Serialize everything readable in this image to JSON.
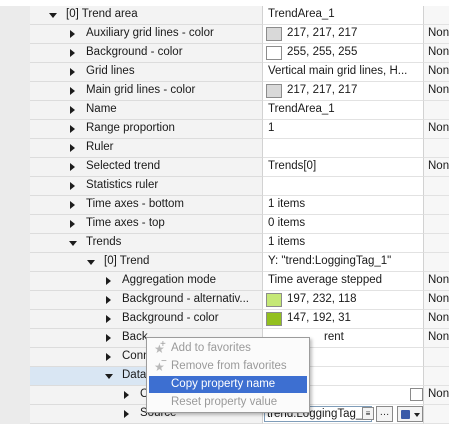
{
  "rows": [
    {
      "label": "[0] Trend area",
      "value": "TrendArea_1",
      "col3": "",
      "level": 0,
      "expander": "down"
    },
    {
      "label": "Auxiliary grid lines - color",
      "value": "217, 217, 217",
      "col3": "Non",
      "level": 1,
      "expander": "right",
      "swatch": "#d9d9d9"
    },
    {
      "label": "Background - color",
      "value": "255, 255, 255",
      "col3": "Non",
      "level": 1,
      "expander": "right",
      "swatch": "#ffffff"
    },
    {
      "label": "Grid lines",
      "value": "Vertical main grid lines, H...",
      "col3": "Non",
      "level": 1,
      "expander": "right"
    },
    {
      "label": "Main grid lines - color",
      "value": "217, 217, 217",
      "col3": "Non",
      "level": 1,
      "expander": "right",
      "swatch": "#d9d9d9"
    },
    {
      "label": "Name",
      "value": "TrendArea_1",
      "col3": "",
      "level": 1,
      "expander": "right"
    },
    {
      "label": "Range proportion",
      "value": "1",
      "col3": "Non",
      "level": 1,
      "expander": "right"
    },
    {
      "label": "Ruler",
      "value": "",
      "col3": "",
      "level": 1,
      "expander": "right"
    },
    {
      "label": "Selected trend",
      "value": "Trends[0]",
      "col3": "Non",
      "level": 1,
      "expander": "right"
    },
    {
      "label": "Statistics ruler",
      "value": "",
      "col3": "",
      "level": 1,
      "expander": "right"
    },
    {
      "label": "Time axes - bottom",
      "value": "1 items",
      "col3": "",
      "level": 1,
      "expander": "right"
    },
    {
      "label": "Time axes - top",
      "value": "0 items",
      "col3": "",
      "level": 1,
      "expander": "right"
    },
    {
      "label": "Trends",
      "value": "1 items",
      "col3": "",
      "level": 1,
      "expander": "down"
    },
    {
      "label": "[0] Trend",
      "value": "Y: \"trend:LoggingTag_1\"",
      "col3": "",
      "level": 2,
      "expander": "down"
    },
    {
      "label": "Aggregation mode",
      "value": "Time average stepped",
      "col3": "Non",
      "level": 3,
      "expander": "right"
    },
    {
      "label": "Background - alternativ...",
      "value": "197, 232, 118",
      "col3": "Non",
      "level": 3,
      "expander": "right",
      "swatch": "#c5e876"
    },
    {
      "label": "Background - color",
      "value": "147, 192, 31",
      "col3": "Non",
      "level": 3,
      "expander": "right",
      "swatch": "#93c01f"
    },
    {
      "label": "Back",
      "value": "rent",
      "col3": "Non",
      "level": 3,
      "expander": "right"
    },
    {
      "label": "Conn",
      "value": "",
      "col3": "",
      "level": 3,
      "expander": "right"
    },
    {
      "label": "Data",
      "value": "",
      "col3": "",
      "level": 3,
      "expander": "down"
    },
    {
      "label": "C",
      "value": "",
      "col3": "Non",
      "level": 4,
      "expander": "right",
      "checkbox": true
    },
    {
      "label": "Source",
      "value": "trend:LoggingTag_1",
      "col3": "",
      "level": 4,
      "expander": "right",
      "source": true
    }
  ],
  "context_menu": {
    "items": [
      {
        "label": "Add to favorites",
        "state": "disabled",
        "icon": "star-add-icon"
      },
      {
        "label": "Remove from favorites",
        "state": "disabled",
        "icon": "star-remove-icon"
      },
      {
        "label": "Copy property name",
        "state": "highlighted",
        "icon": ""
      },
      {
        "label": "Reset property value",
        "state": "disabled",
        "icon": ""
      }
    ]
  },
  "colors": {
    "highlight": "#3d6fd1",
    "tree_bg": "#f3f3f3",
    "selected_row": "#d9e6f3"
  }
}
